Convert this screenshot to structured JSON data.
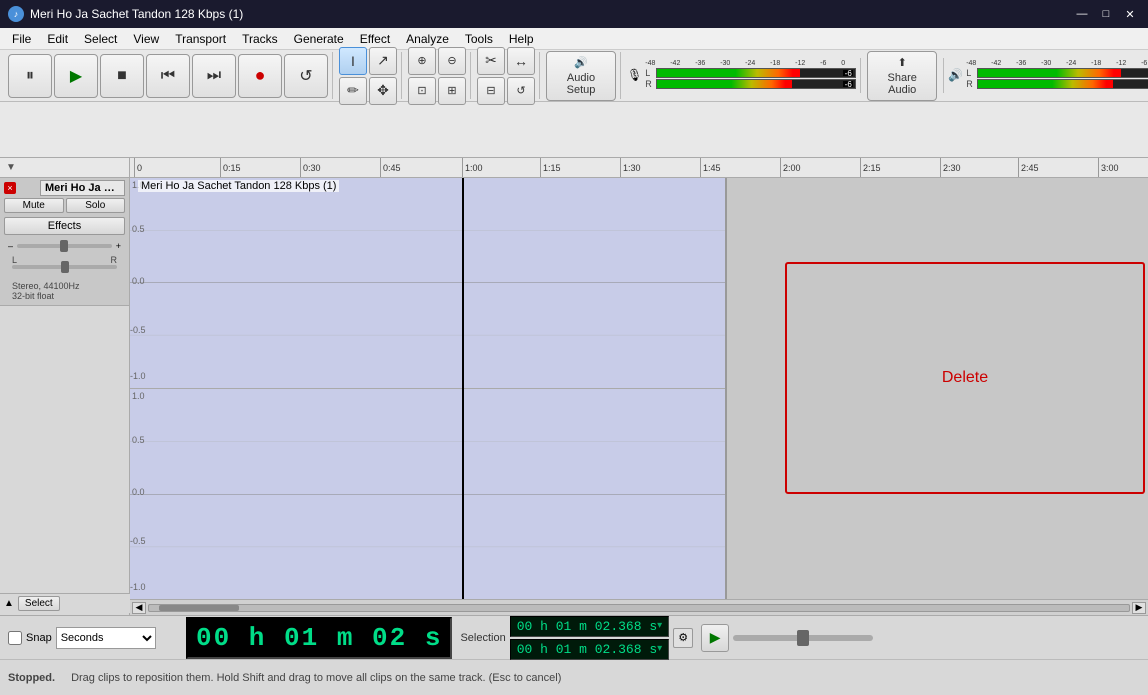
{
  "titlebar": {
    "title": "Meri Ho Ja Sachet Tandon 128 Kbps (1)",
    "icon": "♪",
    "min_btn": "—",
    "max_btn": "□",
    "close_btn": "✕"
  },
  "menubar": {
    "items": [
      "File",
      "Edit",
      "Select",
      "View",
      "Transport",
      "Tracks",
      "Generate",
      "Effect",
      "Analyze",
      "Tools",
      "Help"
    ]
  },
  "toolbar": {
    "transport": {
      "pause_label": "⏸",
      "play_label": "▶",
      "stop_label": "■",
      "prev_label": "⏮",
      "next_label": "⏭",
      "record_label": "●",
      "loop_label": "↺"
    },
    "tools": {
      "select_label": "I",
      "envelope_label": "↗",
      "zoom_in_label": "🔍+",
      "zoom_out_label": "🔍-",
      "zoom_sel_label": "⊡",
      "zoom_fit_label": "⊞",
      "zoom_full_label": "⊟",
      "trim_label": "✂",
      "draw_label": "✏",
      "multi_label": "✥",
      "time_shift_label": "↔"
    },
    "audio_setup": {
      "icon": "🔊",
      "label": "Audio Setup"
    },
    "share_audio": {
      "icon": "⬆",
      "label": "Share Audio"
    },
    "gain_label": "🔊",
    "monitor_label": "🔇"
  },
  "vu_meter": {
    "scale": [
      "-48",
      "-42",
      "-36",
      "-30",
      "-24",
      "-18",
      "-12",
      "-6",
      "0"
    ],
    "peak_L": "-6",
    "peak_R": "-6"
  },
  "track": {
    "name": "Meri Ho Ja S…",
    "close": "×",
    "mute_label": "Mute",
    "solo_label": "Solo",
    "effects_label": "Effects",
    "select_label": "Select",
    "track_info_line1": "Stereo, 44100Hz",
    "track_info_line2": "32-bit float",
    "waveform_title": "Meri Ho Ja Sachet Tandon 128 Kbps (1)",
    "delete_label": "Delete"
  },
  "ruler": {
    "marks": [
      "0",
      "0:15",
      "0:30",
      "0:45",
      "1:00",
      "1:15",
      "1:30",
      "1:45",
      "2:00",
      "2:15",
      "2:30",
      "2:45",
      "3:00"
    ]
  },
  "statusbar": {
    "snap_label": "Snap",
    "seconds_label": "Seconds",
    "time_display": "00 h 01 m 02 s",
    "selection_label": "Selection",
    "selection_start": "00 h 01 m 02.368 s",
    "selection_end": "00 h 01 m 02.368 s",
    "status_text": "Stopped.",
    "hint_text": "Drag clips to reposition them. Hold Shift and drag to move all clips on the same track. (Esc to cancel)"
  }
}
